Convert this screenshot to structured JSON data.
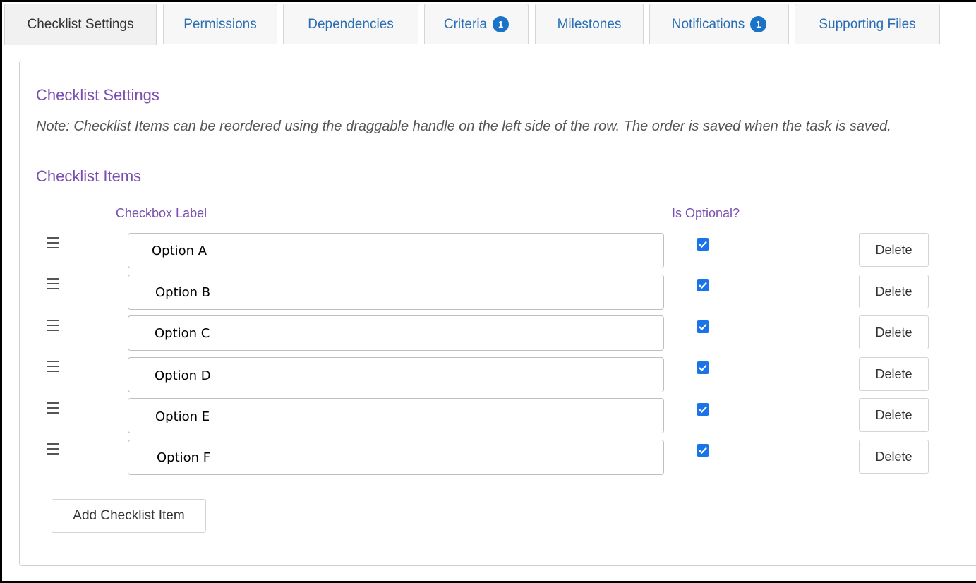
{
  "tabs": [
    {
      "label": "Checklist Settings",
      "badge": ""
    },
    {
      "label": "Permissions",
      "badge": ""
    },
    {
      "label": "Dependencies",
      "badge": ""
    },
    {
      "label": "Criteria",
      "badge": "1"
    },
    {
      "label": "Milestones",
      "badge": ""
    },
    {
      "label": "Notifications",
      "badge": "1"
    },
    {
      "label": "Supporting Files",
      "badge": ""
    }
  ],
  "panel": {
    "title": "Checklist Settings",
    "note": "Note: Checklist Items can be reordered using the draggable handle on the left side of the row. The order is saved when the task is saved.",
    "items_heading": "Checklist Items",
    "columns": {
      "label": "Checkbox Label",
      "optional": "Is Optional?"
    },
    "items": [
      {
        "label": "Option A",
        "optional": true,
        "delete_label": "Delete"
      },
      {
        "label": "Option B",
        "optional": true,
        "delete_label": "Delete"
      },
      {
        "label": "Option C",
        "optional": true,
        "delete_label": "Delete"
      },
      {
        "label": "Option D",
        "optional": true,
        "delete_label": "Delete"
      },
      {
        "label": "Option E",
        "optional": true,
        "delete_label": "Delete"
      },
      {
        "label": "Option F",
        "optional": true,
        "delete_label": "Delete"
      }
    ],
    "add_button_label": "Add Checklist Item"
  },
  "colors": {
    "accent": "#7a4fb0",
    "link": "#2a6fb3",
    "badge": "#1a73c7",
    "checkbox": "#1a73e8"
  }
}
